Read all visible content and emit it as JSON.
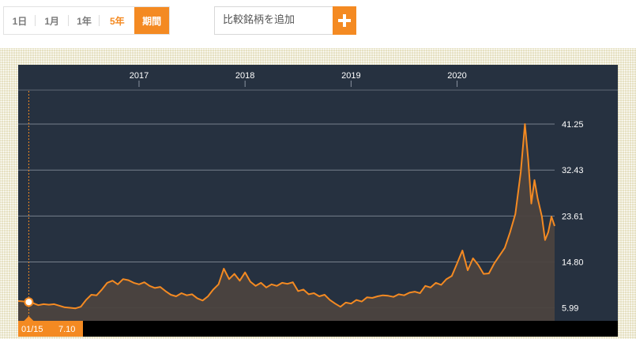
{
  "range_tabs": [
    {
      "label": "1日"
    },
    {
      "label": "1月"
    },
    {
      "label": "1年"
    },
    {
      "label": "5年"
    },
    {
      "label": "期間"
    }
  ],
  "compare": {
    "placeholder": "比較銘柄を追加",
    "button_icon": "plus-icon"
  },
  "colors": {
    "accent": "#f48a22",
    "plot_bg": "#263140",
    "frame": "#e6e0c2",
    "area": "#4b433f"
  },
  "chart_data": {
    "type": "area",
    "x_unit": "year",
    "x_ticks": [
      {
        "label": "2017",
        "x": 2017.0
      },
      {
        "label": "2018",
        "x": 2018.0
      },
      {
        "label": "2019",
        "x": 2019.0
      },
      {
        "label": "2020",
        "x": 2020.0
      }
    ],
    "y_ticks": [
      "41.25",
      "32.43",
      "23.61",
      "14.80",
      "5.99"
    ],
    "ylim": [
      3.5,
      45.5
    ],
    "xlim": [
      2015.86,
      2020.92
    ],
    "grid": true,
    "crosshair": {
      "x": 2015.96,
      "date_label": "01/15",
      "value_label": "7.10"
    },
    "series": [
      {
        "points": [
          [
            2015.86,
            7.3
          ],
          [
            2015.92,
            7.2
          ],
          [
            2015.96,
            7.1
          ],
          [
            2016.0,
            6.9
          ],
          [
            2016.05,
            6.5
          ],
          [
            2016.1,
            6.7
          ],
          [
            2016.15,
            6.6
          ],
          [
            2016.2,
            6.7
          ],
          [
            2016.25,
            6.4
          ],
          [
            2016.3,
            6.1
          ],
          [
            2016.35,
            6.0
          ],
          [
            2016.4,
            5.9
          ],
          [
            2016.45,
            6.2
          ],
          [
            2016.5,
            7.5
          ],
          [
            2016.55,
            8.5
          ],
          [
            2016.6,
            8.4
          ],
          [
            2016.65,
            9.5
          ],
          [
            2016.7,
            10.8
          ],
          [
            2016.75,
            11.2
          ],
          [
            2016.8,
            10.5
          ],
          [
            2016.85,
            11.5
          ],
          [
            2016.9,
            11.3
          ],
          [
            2016.95,
            10.8
          ],
          [
            2017.0,
            10.5
          ],
          [
            2017.05,
            10.9
          ],
          [
            2017.1,
            10.2
          ],
          [
            2017.15,
            9.8
          ],
          [
            2017.2,
            10.0
          ],
          [
            2017.25,
            9.2
          ],
          [
            2017.3,
            8.5
          ],
          [
            2017.35,
            8.2
          ],
          [
            2017.4,
            8.8
          ],
          [
            2017.45,
            8.4
          ],
          [
            2017.5,
            8.6
          ],
          [
            2017.55,
            7.8
          ],
          [
            2017.6,
            7.4
          ],
          [
            2017.65,
            8.2
          ],
          [
            2017.7,
            9.5
          ],
          [
            2017.75,
            10.5
          ],
          [
            2017.8,
            13.5
          ],
          [
            2017.85,
            11.5
          ],
          [
            2017.9,
            12.5
          ],
          [
            2017.95,
            11.2
          ],
          [
            2018.0,
            12.8
          ],
          [
            2018.05,
            11.0
          ],
          [
            2018.1,
            10.2
          ],
          [
            2018.15,
            10.8
          ],
          [
            2018.2,
            9.9
          ],
          [
            2018.25,
            10.5
          ],
          [
            2018.3,
            10.2
          ],
          [
            2018.35,
            10.8
          ],
          [
            2018.4,
            10.6
          ],
          [
            2018.45,
            10.9
          ],
          [
            2018.5,
            9.2
          ],
          [
            2018.55,
            9.5
          ],
          [
            2018.6,
            8.6
          ],
          [
            2018.65,
            8.8
          ],
          [
            2018.7,
            8.2
          ],
          [
            2018.75,
            8.5
          ],
          [
            2018.8,
            7.5
          ],
          [
            2018.85,
            6.8
          ],
          [
            2018.9,
            6.2
          ],
          [
            2018.95,
            7.0
          ],
          [
            2019.0,
            6.8
          ],
          [
            2019.05,
            7.5
          ],
          [
            2019.1,
            7.2
          ],
          [
            2019.15,
            8.0
          ],
          [
            2019.2,
            7.9
          ],
          [
            2019.25,
            8.2
          ],
          [
            2019.3,
            8.4
          ],
          [
            2019.35,
            8.3
          ],
          [
            2019.4,
            8.1
          ],
          [
            2019.45,
            8.6
          ],
          [
            2019.5,
            8.4
          ],
          [
            2019.55,
            8.9
          ],
          [
            2019.6,
            9.1
          ],
          [
            2019.65,
            8.8
          ],
          [
            2019.7,
            10.2
          ],
          [
            2019.75,
            9.9
          ],
          [
            2019.8,
            10.8
          ],
          [
            2019.85,
            10.4
          ],
          [
            2019.9,
            11.5
          ],
          [
            2019.95,
            12.1
          ],
          [
            2020.0,
            14.5
          ],
          [
            2020.05,
            17.0
          ],
          [
            2020.1,
            13.2
          ],
          [
            2020.15,
            15.5
          ],
          [
            2020.2,
            14.2
          ],
          [
            2020.25,
            12.5
          ],
          [
            2020.3,
            12.6
          ],
          [
            2020.35,
            14.5
          ],
          [
            2020.4,
            16.0
          ],
          [
            2020.45,
            17.5
          ],
          [
            2020.5,
            20.5
          ],
          [
            2020.55,
            24.0
          ],
          [
            2020.6,
            32.0
          ],
          [
            2020.64,
            41.25
          ],
          [
            2020.67,
            34.5
          ],
          [
            2020.7,
            26.0
          ],
          [
            2020.73,
            30.5
          ],
          [
            2020.76,
            27.0
          ],
          [
            2020.8,
            23.5
          ],
          [
            2020.83,
            19.0
          ],
          [
            2020.86,
            20.5
          ],
          [
            2020.89,
            23.5
          ],
          [
            2020.92,
            21.7
          ]
        ]
      }
    ]
  }
}
